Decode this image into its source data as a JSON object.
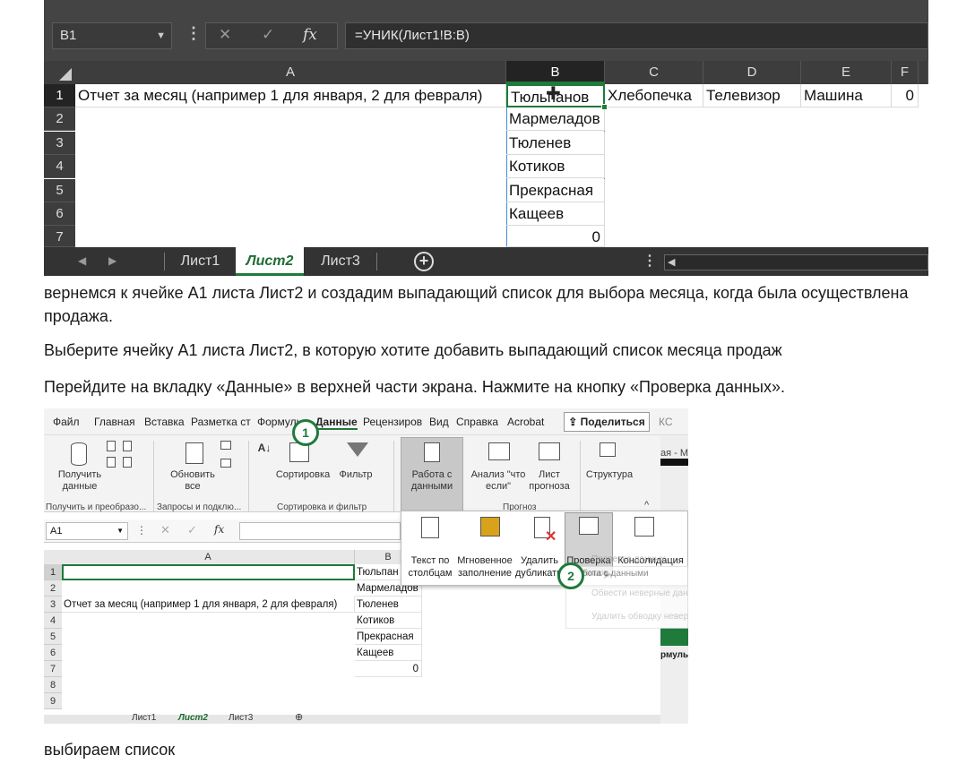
{
  "shot1": {
    "namebox": "B1",
    "fx": "fx",
    "formula": "=УНИК(Лист1!B:B)",
    "columns": [
      "A",
      "B",
      "C",
      "D",
      "E",
      "F"
    ],
    "rows": [
      "1",
      "2",
      "3",
      "4",
      "5",
      "6",
      "7"
    ],
    "cells": {
      "a1": "Отчет за месяц (например 1 для января, 2 для февраля)",
      "b1": "Тюльпанов",
      "c1": "Хлебопечка",
      "d1": "Телевизор",
      "e1": "Машина",
      "f1": "0",
      "b2": "Мармеладов",
      "b3": "Тюленев",
      "b4": "Котиков",
      "b5": "Прекрасная",
      "b6": "Кащеев",
      "b7": "0"
    },
    "tabs": [
      "Лист1",
      "Лист2",
      "Лист3"
    ],
    "active_tab": "Лист2"
  },
  "text": {
    "p1": "вернемся к ячейке А1 листа Лист2 и создадим выпадающий список для выбора месяца, когда была осуществлена продажа.",
    "p2": "Выберите ячейку А1 листа Лист2, в которую хотите добавить выпадающий список месяца продаж",
    "p3": "Перейдите на вкладку «Данные» в верхней части экрана. Нажмите на кнопку «Проверка данных».",
    "p4": "выбираем список"
  },
  "shot2": {
    "ribbon_tabs": [
      "Файл",
      "Главная",
      "Вставка",
      "Разметка ст",
      "Формулы",
      "Данные",
      "Рецензиров",
      "Вид",
      "Справка",
      "Acrobat"
    ],
    "active_ribbon_tab": "Данные",
    "share": "Поделиться",
    "right_tail": "КС",
    "right_tail2": "ая - М",
    "buttons": {
      "get_data": "Получить данные",
      "refresh": "Обновить все",
      "sort": "Сортировка",
      "filter": "Фильтр",
      "data_tools": "Работа с данными",
      "whatif": "Анализ \"что если\"",
      "forecast": "Лист прогноза",
      "outline": "Структура"
    },
    "groups": {
      "g1": "Получить и преобразо...",
      "g2": "Запросы и подклю...",
      "g3": "Сортировка и фильтр",
      "g4": "Прогноз"
    },
    "namebox": "A1",
    "fx": "fx",
    "columns": [
      "A",
      "B"
    ],
    "rows": [
      "1",
      "2",
      "3",
      "4",
      "5",
      "6",
      "7",
      "8",
      "9"
    ],
    "cells": {
      "a3": "Отчет за месяц (например 1 для января, 2 для февраля)",
      "b1": "Тюльпан",
      "b2": "Мармеладов",
      "b3": "Тюленев",
      "b4": "Котиков",
      "b5": "Прекрасная",
      "b6": "Кащеев",
      "b7": "0"
    },
    "dropdown": {
      "text_to_cols": "Текст по столбцам",
      "flash_fill": "Мгновенное заполнение",
      "remove_dup": "Удалить дубликаты",
      "validation": "Проверка данных",
      "consolidate": "Консолидация",
      "sub1": "Проверка данных...",
      "sub2": "Обвести неверные данные",
      "sub3": "Удалить обводку неверных данных",
      "worktitle": "Работа с данными"
    },
    "side": {
      "formulas": "рмулы"
    },
    "badges": [
      "1",
      "2"
    ],
    "tabs": [
      "Лист1",
      "Лист2",
      "Лист3"
    ],
    "active_tab": "Лист2"
  }
}
